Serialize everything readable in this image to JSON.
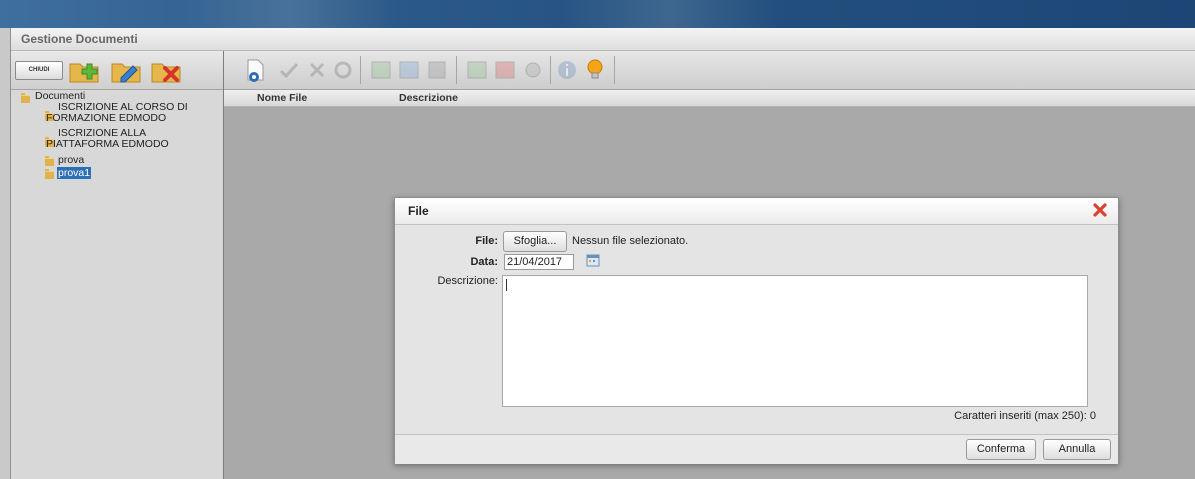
{
  "app": {
    "title": "Gestione Documenti"
  },
  "left_toolbar": {
    "close_label": "CHIUDI"
  },
  "tree": {
    "root": "Documenti",
    "items": [
      {
        "lines": [
          "ISCRIZIONE AL CORSO DI",
          "FORMAZIONE EDMODO"
        ],
        "selected": false
      },
      {
        "lines": [
          "ISCRIZIONE ALLA",
          "PIATTAFORMA EDMODO"
        ],
        "selected": false
      },
      {
        "lines": [
          "prova"
        ],
        "selected": false
      },
      {
        "lines": [
          "prova1"
        ],
        "selected": true
      }
    ]
  },
  "table": {
    "columns": [
      "Nome File",
      "Descrizione"
    ]
  },
  "dialog": {
    "title": "File",
    "file_label": "File:",
    "browse_label": "Sfoglia...",
    "no_file_text": "Nessun file selezionato.",
    "date_label": "Data:",
    "date_value": "21/04/2017",
    "desc_label": "Descrizione:",
    "desc_value": "",
    "counter_text": "Caratteri inseriti (max 250): 0",
    "confirm_label": "Conferma",
    "cancel_label": "Annulla"
  },
  "colors": {
    "selection": "#2b6fb7",
    "close_red": "#e0402e",
    "folder": "#e2b34a",
    "accent_green": "#6cc04a"
  },
  "icons": [
    "new-folder-icon",
    "edit-folder-icon",
    "delete-folder-icon",
    "add-file-icon",
    "info-icon",
    "lightbulb-icon",
    "calendar-icon",
    "close-icon"
  ]
}
